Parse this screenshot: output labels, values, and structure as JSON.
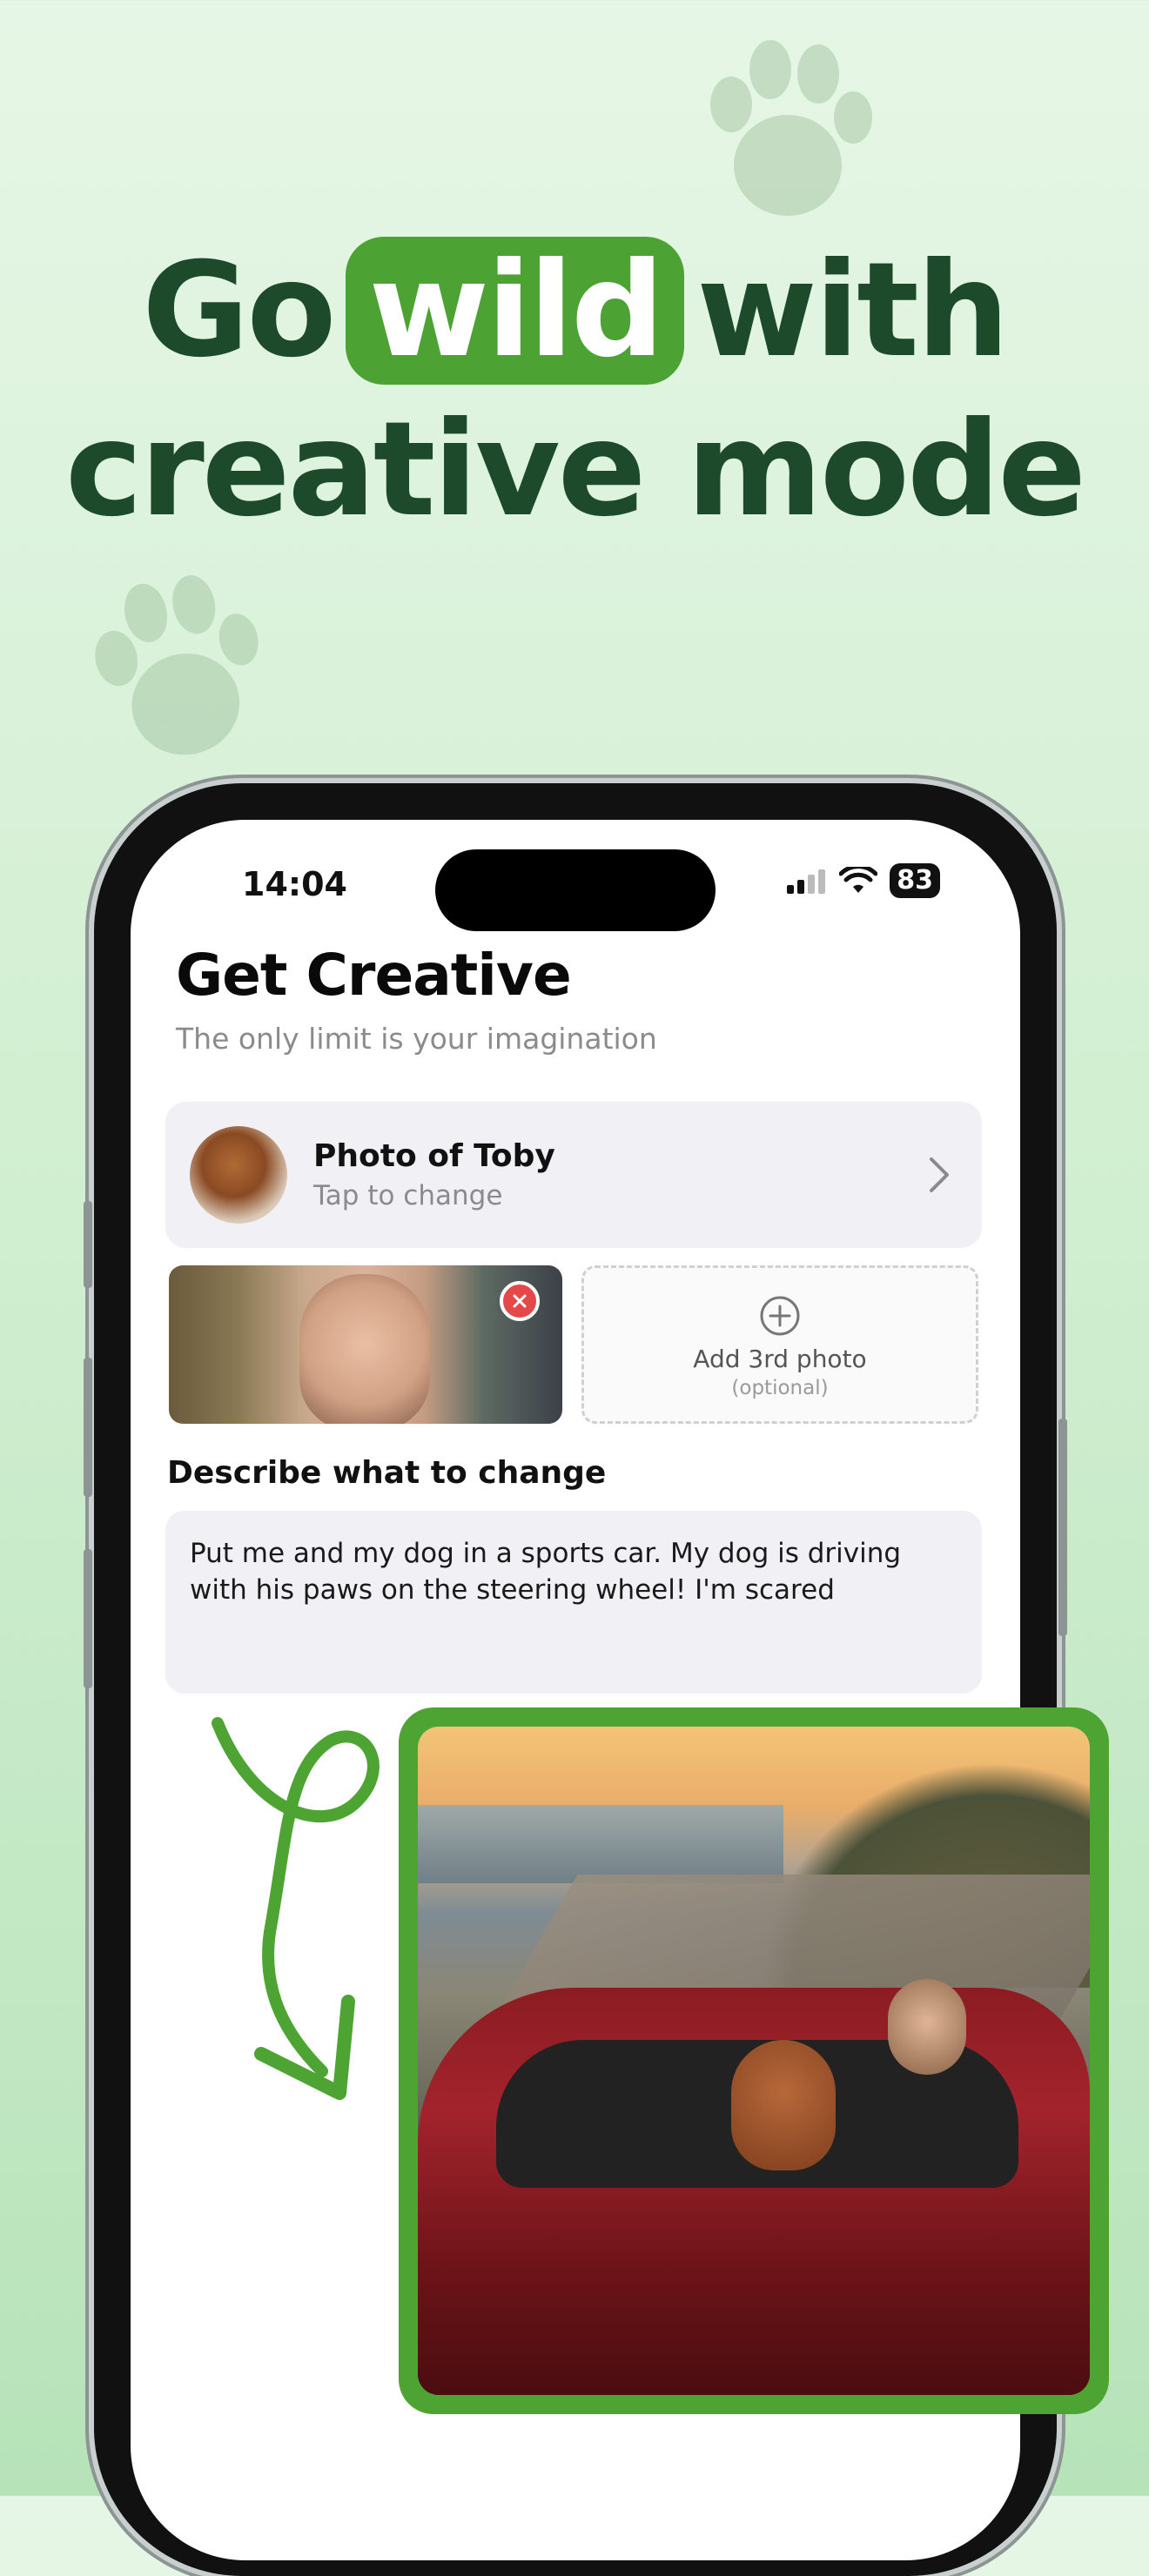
{
  "headline": {
    "line1_before": "Go",
    "line1_highlight": "wild",
    "line1_after": "with",
    "line2": "creative mode",
    "colors": {
      "text": "#1d4a2a",
      "highlight_bg": "#4ca333",
      "highlight_text": "#ffffff"
    }
  },
  "status_bar": {
    "time": "14:04",
    "battery": "83"
  },
  "screen": {
    "title": "Get Creative",
    "subtitle": "The only limit is your imagination",
    "pet_card": {
      "name": "Photo of Toby",
      "hint": "Tap to change"
    },
    "add_photo": {
      "label": "Add 3rd photo",
      "optional": "(optional)"
    },
    "describe_label": "Describe what to change",
    "description": "Put me and my dog in a sports car. My dog is driving with his paws on the steering wheel! I'm scared"
  },
  "colors": {
    "accent_green": "#4ea432",
    "remove_red": "#e54848",
    "card_bg": "#f0f0f5"
  }
}
